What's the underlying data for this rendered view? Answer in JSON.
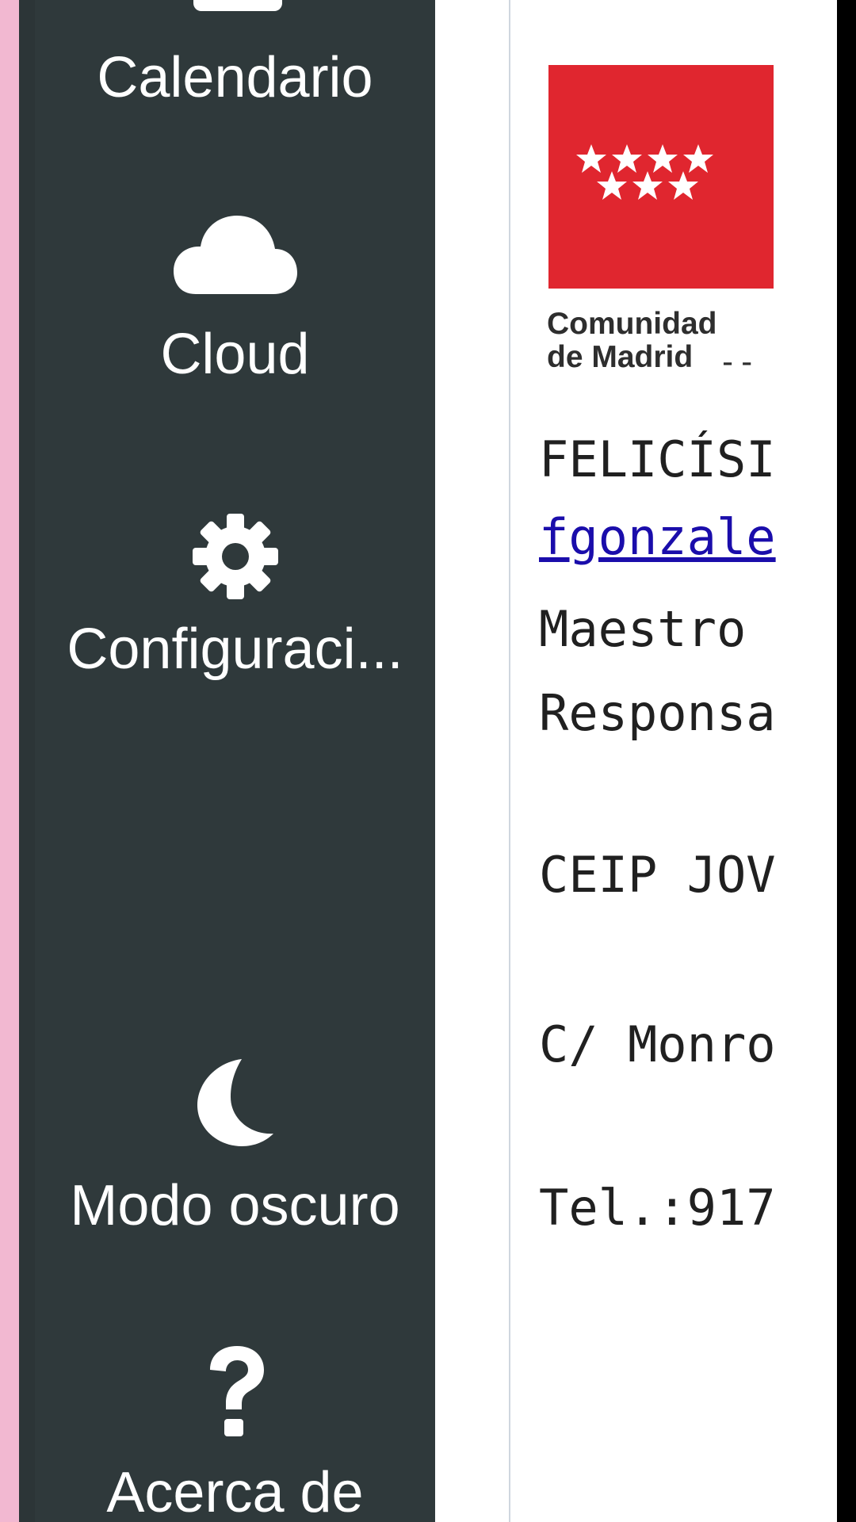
{
  "colors": {
    "sidebar_bg": "#2f393b",
    "accent_strip": "#f2b8d1",
    "icon_white": "#ffffff",
    "logo_red": "#e0262f",
    "link_blue": "#1a0dab",
    "content_bg": "#ffffff"
  },
  "sidebar": {
    "items": [
      {
        "label": "Calendario",
        "icon": "calendar-icon"
      },
      {
        "label": "Cloud",
        "icon": "cloud-icon"
      },
      {
        "label": "Configuraci...",
        "icon": "gear-icon"
      },
      {
        "label": "Modo oscuro",
        "icon": "moon-icon"
      },
      {
        "label": "Acerca de",
        "icon": "question-icon"
      }
    ]
  },
  "signature": {
    "logo": {
      "line1": "Comunidad",
      "line2": "de Madrid",
      "trailing": "--"
    },
    "name": "FELICÍSI",
    "email": "fgonzale",
    "role": "Maestro",
    "responsibility": "Responsa",
    "school": "CEIP JOV",
    "address": "C/ Monro",
    "phone": "Tel.:917"
  }
}
